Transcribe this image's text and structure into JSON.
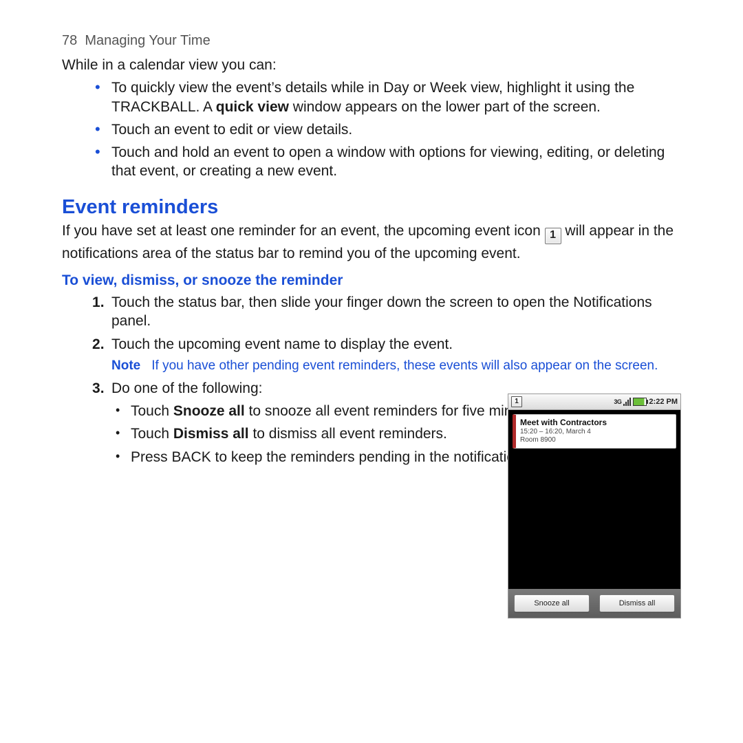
{
  "header": {
    "page_number": "78",
    "chapter": "Managing Your Time"
  },
  "intro": "While in a calendar view you can:",
  "bullets": [
    {
      "pre": "To quickly view the event’s details while in Day or Week view, highlight it using the TRACKBALL. A ",
      "bold": "quick view",
      "post": " window appears on the lower part of the screen."
    },
    {
      "text": "Touch an event to edit or view details."
    },
    {
      "text": "Touch and hold an event to open a window with options for viewing, editing, or deleting that event, or creating a new event."
    }
  ],
  "section_title": "Event reminders",
  "section_para": {
    "pre": "If you have set at least one reminder for an event, the upcoming event icon ",
    "icon_label": "1",
    "post": " will appear in the notifications area of the status bar to remind you of the upcoming event."
  },
  "subsection_title": "To view, dismiss, or snooze the reminder",
  "steps": {
    "s1": "Touch the status bar, then slide your finger down the screen to open the Notifications panel.",
    "s2": "Touch the upcoming event name to display the event.",
    "note_label": "Note",
    "note_text": "If you have other pending event reminders, these events will also appear on the screen.",
    "s3": "Do one of the following:",
    "s3_items": [
      {
        "pre": "Touch ",
        "bold": "Snooze all",
        "post": " to snooze all event reminders for five minutes."
      },
      {
        "pre": "Touch ",
        "bold": "Dismiss all",
        "post": " to dismiss all event reminders."
      },
      {
        "text": "Press BACK to keep the reminders pending in the notifications area of the status bar."
      }
    ]
  },
  "phone": {
    "statusbar": {
      "event_icon": "1",
      "time": "2:22 PM",
      "threeg": "3G"
    },
    "notification": {
      "title": "Meet with Contractors",
      "time": "15:20 – 16:20, March 4",
      "room": "Room 8900"
    },
    "buttons": {
      "snooze": "Snooze all",
      "dismiss": "Dismiss all"
    }
  }
}
